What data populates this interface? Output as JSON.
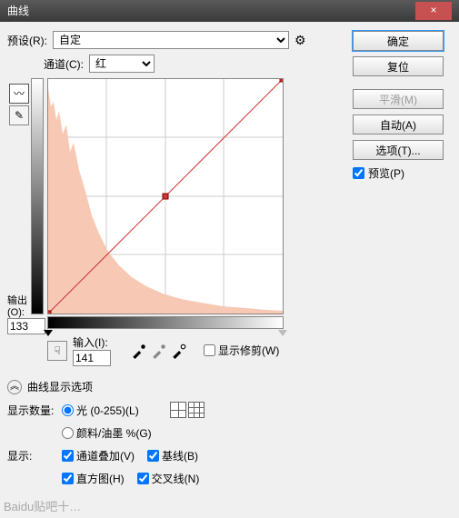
{
  "window": {
    "title": "曲线",
    "close": "×"
  },
  "preset": {
    "label": "预设(R):",
    "value": "自定"
  },
  "channel": {
    "label": "通道(C):",
    "value": "红"
  },
  "output": {
    "label": "输出(O):",
    "value": "133"
  },
  "input": {
    "label": "输入(I):",
    "value": "141"
  },
  "show_clipping": {
    "label": "显示修剪(W)",
    "checked": false
  },
  "display_options_header": "曲线显示选项",
  "amount": {
    "label": "显示数量:",
    "light": {
      "label": "光 (0-255)(L)",
      "selected": true
    },
    "pigment": {
      "label": "颜料/油墨 %(G)",
      "selected": false
    }
  },
  "show": {
    "label": "显示:",
    "overlay": {
      "label": "通道叠加(V)",
      "checked": true
    },
    "baseline": {
      "label": "基线(B)",
      "checked": true
    },
    "histogram": {
      "label": "直方图(H)",
      "checked": true
    },
    "intersection": {
      "label": "交叉线(N)",
      "checked": true
    }
  },
  "buttons": {
    "ok": "确定",
    "cancel": "复位",
    "smooth": "平滑(M)",
    "auto": "自动(A)",
    "options": "选项(T)..."
  },
  "preview": {
    "label": "预览(P)",
    "checked": true
  },
  "watermark": "Baidu贴吧十…"
}
